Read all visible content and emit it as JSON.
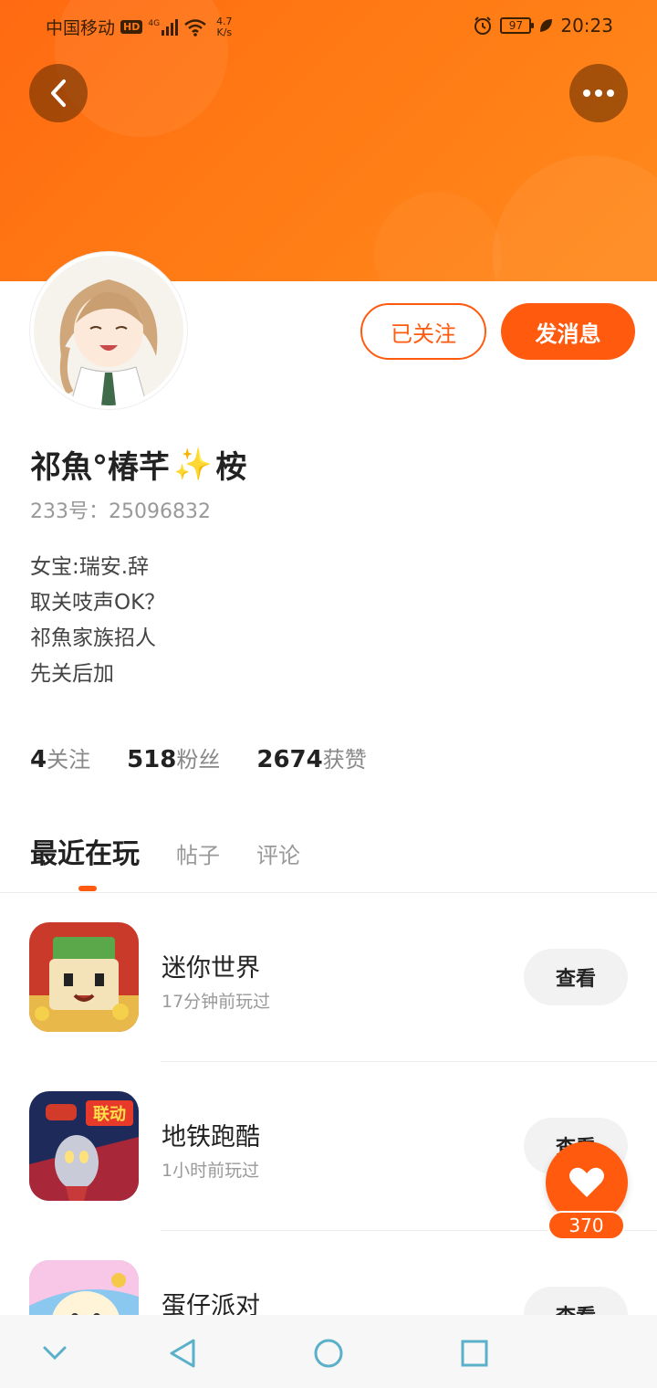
{
  "status_bar": {
    "carrier": "中国移动",
    "hd": "HD",
    "network": "4G",
    "speed_value": "4.7",
    "speed_unit": "K/s",
    "battery": "97",
    "time": "20:23"
  },
  "profile": {
    "name_part1": "祁魚°椿芊",
    "name_sparkle": "✨",
    "name_part2": "桉",
    "uid": "233号：25096832",
    "bio": [
      "女宝:瑞安.辞",
      "取关吱声OK？",
      "祁魚家族招人",
      "先关后加"
    ],
    "follow_label": "已关注",
    "message_label": "发消息"
  },
  "stats": [
    {
      "num": "4",
      "label": "关注"
    },
    {
      "num": "518",
      "label": "粉丝"
    },
    {
      "num": "2674",
      "label": "获赞"
    }
  ],
  "tabs": {
    "active": "最近在玩",
    "posts": "帖子",
    "comments": "评论"
  },
  "games": [
    {
      "name": "迷你世界",
      "time": "17分钟前玩过",
      "button": "查看"
    },
    {
      "name": "地铁跑酷",
      "time": "1小时前玩过",
      "button": "查看",
      "badge": "联动"
    },
    {
      "name": "蛋仔派对",
      "time": "",
      "button": "查看"
    }
  ],
  "like": {
    "count": "370"
  },
  "colors": {
    "accent": "#ff5a0e",
    "banner": "#ff7a14"
  }
}
